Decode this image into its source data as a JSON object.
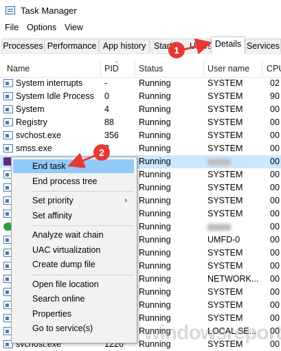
{
  "window": {
    "title": "Task Manager"
  },
  "menu": [
    "File",
    "Options",
    "View"
  ],
  "tabs": [
    "Processes",
    "Performance",
    "App history",
    "Start",
    "Users",
    "Details",
    "Services"
  ],
  "columns": {
    "name": "Name",
    "pid": "PID",
    "status": "Status",
    "user": "User name",
    "cpu": "CPU"
  },
  "rows": [
    {
      "name": "System interrupts",
      "pid": "-",
      "status": "Running",
      "user": "SYSTEM",
      "cpu": "02",
      "icon": "window-icon"
    },
    {
      "name": "System Idle Process",
      "pid": "0",
      "status": "Running",
      "user": "SYSTEM",
      "cpu": "90",
      "icon": "window-icon"
    },
    {
      "name": "System",
      "pid": "4",
      "status": "Running",
      "user": "SYSTEM",
      "cpu": "00",
      "icon": "window-icon"
    },
    {
      "name": "Registry",
      "pid": "88",
      "status": "Running",
      "user": "SYSTEM",
      "cpu": "00",
      "icon": "window-icon"
    },
    {
      "name": "svchost.exe",
      "pid": "356",
      "status": "Running",
      "user": "SYSTEM",
      "cpu": "00",
      "icon": "window-icon"
    },
    {
      "name": "smss.exe",
      "pid": "2",
      "status": "Running",
      "user": "SYSTEM",
      "cpu": "00",
      "icon": "window-icon"
    },
    {
      "name": "",
      "pid": "",
      "status": "Running",
      "user": "",
      "cpu": "00",
      "icon": "purple-app-icon",
      "selected": true
    },
    {
      "name": "",
      "pid": "",
      "status": "Running",
      "user": "SYSTEM",
      "cpu": "00",
      "icon": "window-icon"
    },
    {
      "name": "",
      "pid": "",
      "status": "Running",
      "user": "SYSTEM",
      "cpu": "00",
      "icon": "window-icon"
    },
    {
      "name": "",
      "pid": "",
      "status": "Running",
      "user": "SYSTEM",
      "cpu": "00",
      "icon": "window-icon"
    },
    {
      "name": "",
      "pid": "",
      "status": "Running",
      "user": "SYSTEM",
      "cpu": "00",
      "icon": "window-icon"
    },
    {
      "name": "",
      "pid": "",
      "status": "Running",
      "user": "",
      "cpu": "00",
      "icon": "green-app-icon"
    },
    {
      "name": "",
      "pid": "",
      "status": "Running",
      "user": "UMFD-0",
      "cpu": "00",
      "icon": "window-icon"
    },
    {
      "name": "",
      "pid": "",
      "status": "Running",
      "user": "SYSTEM",
      "cpu": "00",
      "icon": "window-icon"
    },
    {
      "name": "",
      "pid": "",
      "status": "Running",
      "user": "SYSTEM",
      "cpu": "00",
      "icon": "window-icon"
    },
    {
      "name": "",
      "pid": "",
      "status": "Running",
      "user": "NETWORK...",
      "cpu": "00",
      "icon": "window-icon"
    },
    {
      "name": "",
      "pid": "",
      "status": "Running",
      "user": "SYSTEM",
      "cpu": "00",
      "icon": "window-icon"
    },
    {
      "name": "",
      "pid": "",
      "status": "Running",
      "user": "SYSTEM",
      "cpu": "00",
      "icon": "window-icon"
    },
    {
      "name": "",
      "pid": "",
      "status": "Running",
      "user": "SYSTEM",
      "cpu": "00",
      "icon": "window-icon"
    },
    {
      "name": "",
      "pid": "",
      "status": "Running",
      "user": "LOCAL SE...",
      "cpu": "00",
      "icon": "window-icon"
    },
    {
      "name": "svchost.exe",
      "pid": "1226",
      "status": "Running",
      "user": "SYSTEM",
      "cpu": "00",
      "icon": "window-icon"
    }
  ],
  "context_menu": [
    {
      "label": "End task",
      "highlight": true
    },
    {
      "label": "End process tree"
    },
    {
      "separator": true
    },
    {
      "label": "Set priority",
      "submenu": true
    },
    {
      "label": "Set affinity"
    },
    {
      "separator": true
    },
    {
      "label": "Analyze wait chain"
    },
    {
      "label": "UAC virtualization"
    },
    {
      "label": "Create dump file"
    },
    {
      "separator": true
    },
    {
      "label": "Open file location"
    },
    {
      "label": "Search online"
    },
    {
      "label": "Properties"
    },
    {
      "label": "Go to service(s)"
    }
  ],
  "callouts": [
    "1",
    "2"
  ],
  "watermark": "windowsreport",
  "colors": {
    "selection": "#cce8ff",
    "menu_highlight": "#91c9f7",
    "callout": "#e53935"
  }
}
